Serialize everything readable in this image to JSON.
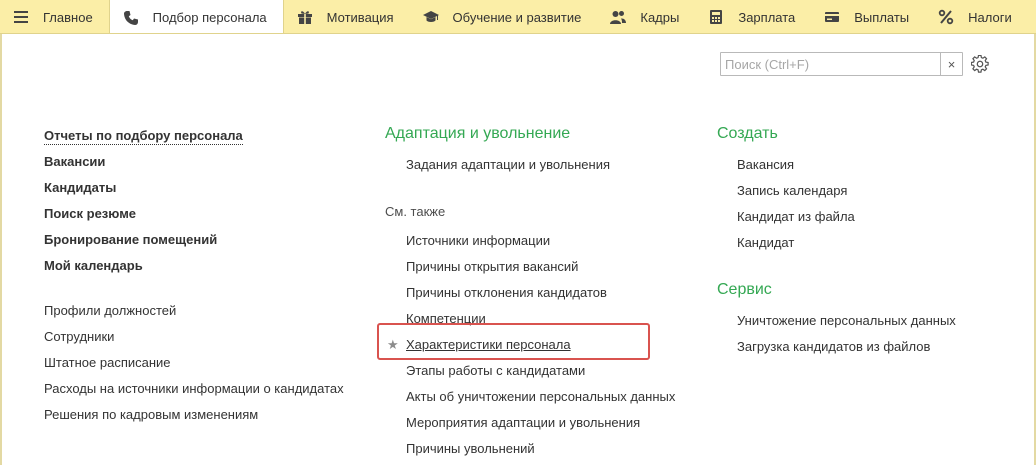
{
  "tabs": [
    {
      "label": "Главное",
      "icon": "menu-icon"
    },
    {
      "label": "Подбор персонала",
      "icon": "phone-icon"
    },
    {
      "label": "Мотивация",
      "icon": "gift-icon"
    },
    {
      "label": "Обучение и развитие",
      "icon": "graduation-cap-icon"
    },
    {
      "label": "Кадры",
      "icon": "people-icon"
    },
    {
      "label": "Зарплата",
      "icon": "calculator-icon"
    },
    {
      "label": "Выплаты",
      "icon": "card-icon"
    },
    {
      "label": "Налоги",
      "icon": "percent-icon"
    }
  ],
  "search": {
    "placeholder": "Поиск (Ctrl+F)",
    "value": "",
    "clear": "×"
  },
  "left": {
    "main": [
      "Отчеты по подбору персонала",
      "Вакансии",
      "Кандидаты",
      "Поиск резюме",
      "Бронирование помещений",
      "Мой календарь"
    ],
    "more": [
      "Профили должностей",
      "Сотрудники",
      "Штатное расписание",
      "Расходы на источники информации о кандидатах",
      "Решения по кадровым изменениям"
    ]
  },
  "middle": {
    "heading": "Адаптация и увольнение",
    "items": [
      "Задания адаптации и увольнения"
    ],
    "see_also": "См. также",
    "see_also_items": [
      "Источники информации",
      "Причины открытия вакансий",
      "Причины отклонения кандидатов",
      "Компетенции",
      "Характеристики персонала",
      "Этапы работы с кандидатами",
      "Акты об уничтожении персональных данных",
      "Мероприятия адаптации и увольнения",
      "Причины увольнений"
    ],
    "favorite_star": "★"
  },
  "right": {
    "create_heading": "Создать",
    "create_items": [
      "Вакансия",
      "Запись календаря",
      "Кандидат из файла",
      "Кандидат"
    ],
    "service_heading": "Сервис",
    "service_items": [
      "Уничтожение персональных данных",
      "Загрузка кандидатов из файлов"
    ]
  },
  "colors": {
    "topbar": "#fbeea7",
    "heading_green": "#34a853",
    "highlight": "#d9534f"
  }
}
